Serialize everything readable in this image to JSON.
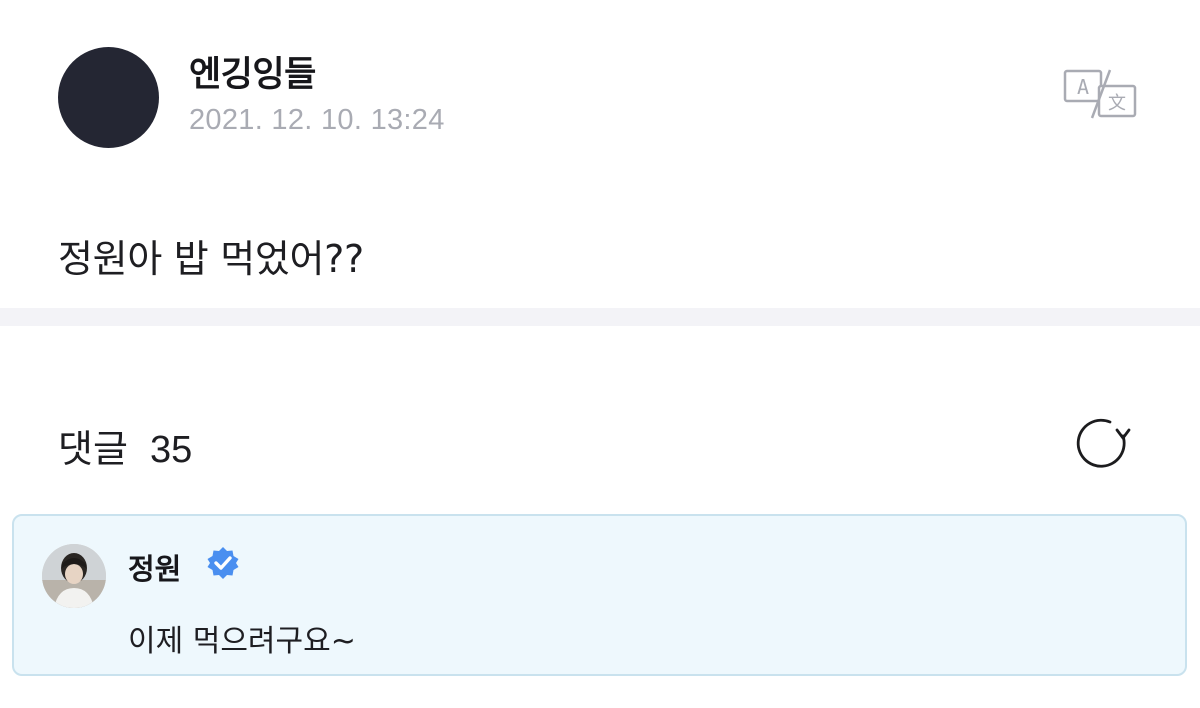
{
  "post": {
    "author": "엔깅잉들",
    "timestamp": "2021. 12. 10. 13:24",
    "body": "정원아 밥 먹었어??",
    "translate_icon": "translate-icon"
  },
  "comments": {
    "label": "댓글",
    "count": "35",
    "refresh_icon": "refresh-icon",
    "items": [
      {
        "author": "정원",
        "verified": true,
        "text": "이제 먹으려구요~"
      }
    ]
  },
  "colors": {
    "avatar": "#242633",
    "timestamp": "#a9abb3",
    "highlight_bg": "#eef8fd",
    "highlight_border": "#c9e2ee",
    "verified": "#4a8ff0"
  }
}
